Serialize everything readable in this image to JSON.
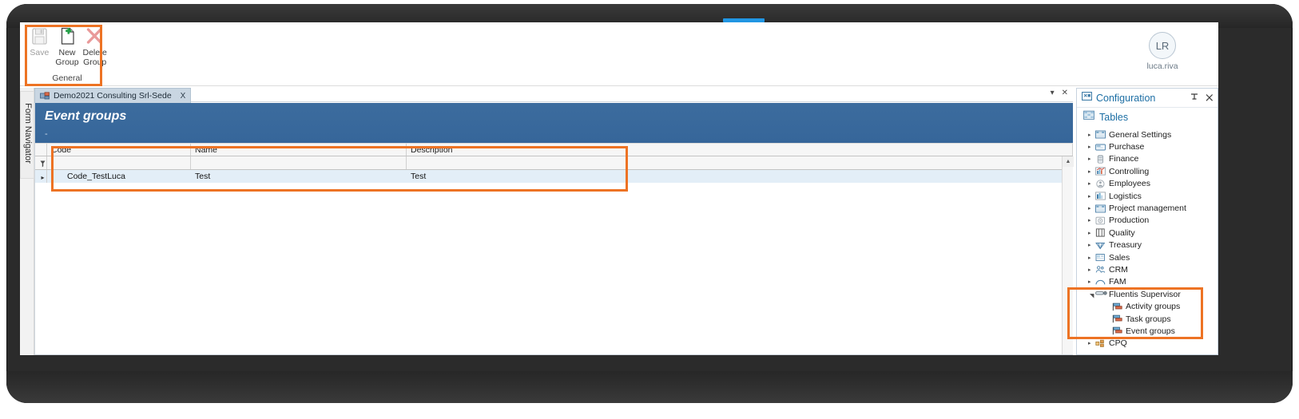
{
  "window": {
    "title_tab": "Demo2021 Consulting Srl-Sede",
    "left_dock_label": "Form Navigator"
  },
  "ribbon": {
    "group_name": "General",
    "buttons": [
      {
        "label_line1": "Save",
        "label_line2": "",
        "icon": "save-icon",
        "enabled": false
      },
      {
        "label_line1": "New",
        "label_line2": "Group",
        "icon": "new-document-icon",
        "enabled": true
      },
      {
        "label_line1": "Delete",
        "label_line2": "Group",
        "icon": "delete-x-icon",
        "enabled": true
      }
    ]
  },
  "account": {
    "initials": "LR",
    "username": "luca.riva"
  },
  "tabstrip": {
    "dropdown_icon": "chevron-down-icon",
    "close_icon": "close-icon",
    "tab_close_label": "X"
  },
  "document": {
    "title": "Event groups",
    "subtitle": "-"
  },
  "grid": {
    "columns": [
      "Code",
      "Name",
      "Description"
    ],
    "filter_icon": "filter-icon",
    "row_indicator": "▸",
    "rows": [
      {
        "code": "Code_TestLuca",
        "name": "Test",
        "description": "Test"
      }
    ],
    "scroll_up_icon": "▲",
    "scroll_down_icon": "▼"
  },
  "config_panel": {
    "title": "Configuration",
    "title_icon": "configuration-icon",
    "pin_icon": "pin-icon",
    "close_icon": "close-icon",
    "tables_label": "Tables",
    "tables_icon": "tables-icon",
    "tree": [
      {
        "label": "General Settings",
        "icon": "folder-settings-icon",
        "level": 0,
        "expanded": false
      },
      {
        "label": "Purchase",
        "icon": "purchase-icon",
        "level": 0,
        "expanded": false
      },
      {
        "label": "Finance",
        "icon": "finance-icon",
        "level": 0,
        "expanded": false
      },
      {
        "label": "Controlling",
        "icon": "chart-icon",
        "level": 0,
        "expanded": false
      },
      {
        "label": "Employees",
        "icon": "employees-icon",
        "level": 0,
        "expanded": false
      },
      {
        "label": "Logistics",
        "icon": "logistics-icon",
        "level": 0,
        "expanded": false
      },
      {
        "label": "Project management",
        "icon": "project-icon",
        "level": 0,
        "expanded": false
      },
      {
        "label": "Production",
        "icon": "production-icon",
        "level": 0,
        "expanded": false
      },
      {
        "label": "Quality",
        "icon": "quality-icon",
        "level": 0,
        "expanded": false
      },
      {
        "label": "Treasury",
        "icon": "treasury-icon",
        "level": 0,
        "expanded": false
      },
      {
        "label": "Sales",
        "icon": "sales-icon",
        "level": 0,
        "expanded": false
      },
      {
        "label": "CRM",
        "icon": "crm-icon",
        "level": 0,
        "expanded": false
      },
      {
        "label": "FAM",
        "icon": "fam-icon",
        "level": 0,
        "expanded": false
      },
      {
        "label": "Fluentis Supervisor",
        "icon": "supervisor-icon",
        "level": 0,
        "expanded": true
      },
      {
        "label": "Activity groups",
        "icon": "group-icon",
        "level": 1,
        "expanded": false
      },
      {
        "label": "Task groups",
        "icon": "group-icon",
        "level": 1,
        "expanded": false
      },
      {
        "label": "Event groups",
        "icon": "group-icon",
        "level": 1,
        "expanded": false
      },
      {
        "label": "CPQ",
        "icon": "cpq-icon",
        "level": 0,
        "expanded": false
      }
    ]
  },
  "colors": {
    "accent_blue": "#36669a",
    "highlight_orange": "#ed7324",
    "link_blue": "#1c6ea4",
    "row_selected": "#e3eef7"
  }
}
